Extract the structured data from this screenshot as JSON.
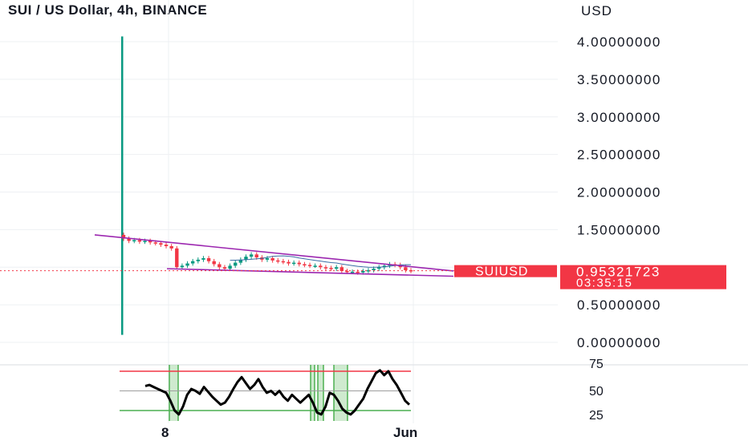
{
  "header": {
    "title": "SUI / US Dollar, 4h, BINANCE"
  },
  "chart_data": {
    "type": "candlestick",
    "symbol": "SUIUSD",
    "exchange": "BINANCE",
    "interval": "4h",
    "currency_label": "USD",
    "y_ticks": [
      "4.00000000",
      "3.50000000",
      "3.00000000",
      "2.50000000",
      "2.00000000",
      "1.50000000",
      "0.50000000",
      "0.00000000"
    ],
    "ylim": [
      0,
      4
    ],
    "x_labels": [
      "8",
      "Jun"
    ],
    "last_price": "0.95321723",
    "countdown": "03:35:15",
    "price_label": "SUIUSD",
    "colors": {
      "up": "#089981",
      "down": "#f23645",
      "trendline": "#9c27b0",
      "label_bg": "#f23645",
      "ma": "#3a6ea5"
    },
    "launch_candle": {
      "low": 0.1,
      "high": 4.07
    },
    "close_series": [
      1.38,
      1.35,
      1.36,
      1.34,
      1.35,
      1.33,
      1.32,
      1.3,
      1.28,
      1.25,
      1.0,
      1.02,
      1.05,
      1.08,
      1.1,
      1.12,
      1.08,
      1.04,
      1.0,
      0.98,
      1.02,
      1.06,
      1.1,
      1.14,
      1.17,
      1.13,
      1.1,
      1.12,
      1.09,
      1.08,
      1.07,
      1.05,
      1.06,
      1.04,
      1.03,
      1.02,
      1.02,
      1.0,
      0.99,
      0.98,
      1.0,
      0.95,
      0.94,
      0.94,
      0.93,
      0.95,
      0.96,
      0.98,
      1.0,
      1.02,
      1.04,
      1.03,
      1.0,
      0.96,
      0.95
    ],
    "trendlines": [
      {
        "from": [
          0,
          1.43
        ],
        "to": [
          1,
          0.95
        ]
      },
      {
        "from": [
          0,
          0.98
        ],
        "to": [
          1,
          0.88
        ]
      }
    ],
    "rsi": {
      "ticks": [
        "75",
        "50",
        "25"
      ],
      "upper_band": 70,
      "lower_band": 30,
      "values": [
        55,
        56,
        54,
        52,
        50,
        48,
        40,
        30,
        26,
        34,
        46,
        52,
        50,
        47,
        54,
        49,
        44,
        40,
        36,
        38,
        44,
        52,
        59,
        64,
        58,
        52,
        56,
        62,
        54,
        48,
        50,
        46,
        50,
        44,
        40,
        46,
        42,
        38,
        42,
        46,
        38,
        28,
        26,
        34,
        48,
        46,
        40,
        32,
        28,
        26,
        30,
        36,
        42,
        52,
        60,
        68,
        71,
        66,
        70,
        62,
        56,
        48,
        40,
        36
      ]
    }
  }
}
